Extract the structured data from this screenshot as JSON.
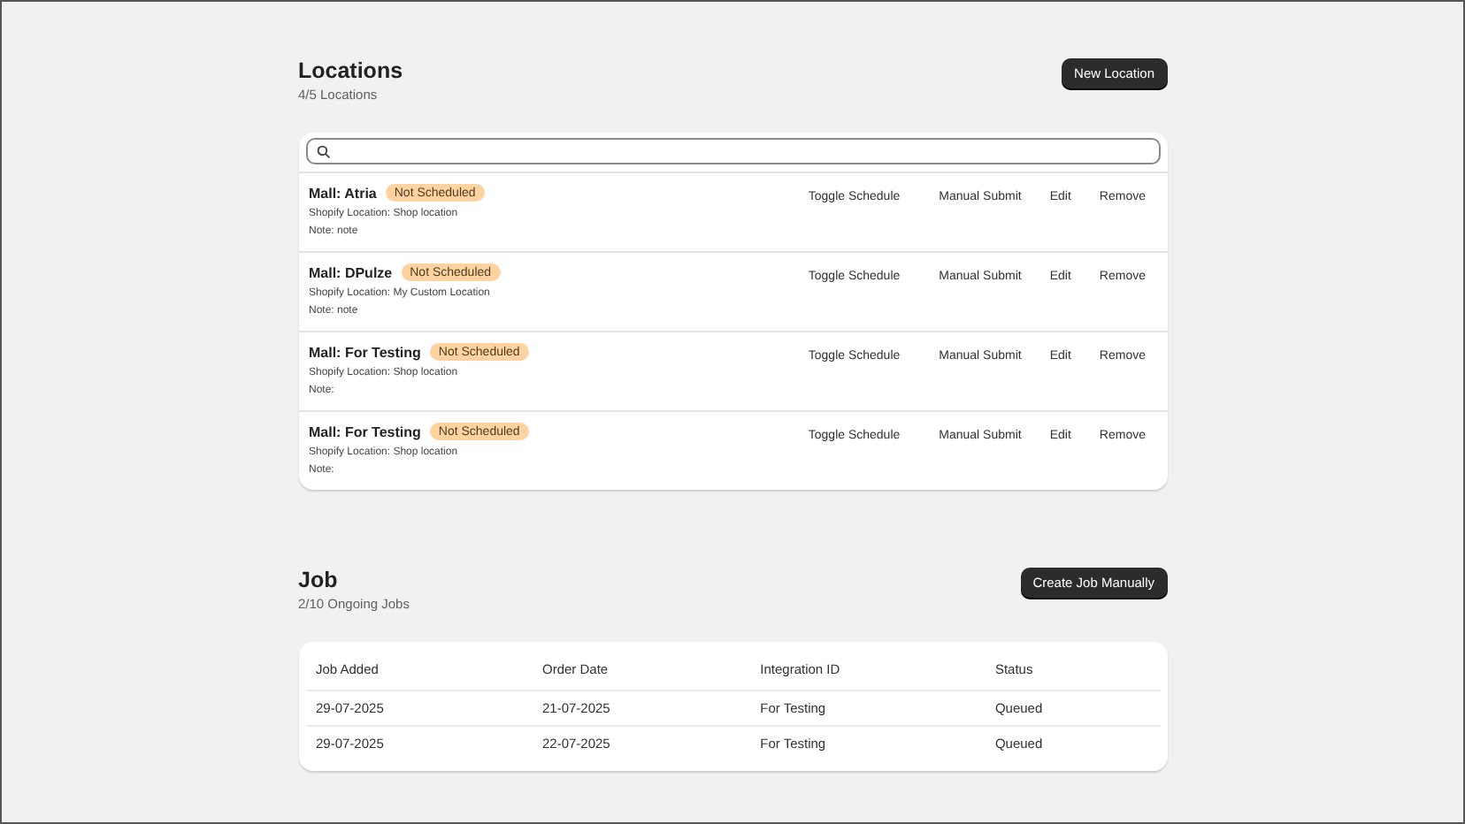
{
  "locations": {
    "title": "Locations",
    "subtitle": "4/5 Locations",
    "new_button": "New Location",
    "items": [
      {
        "name": "Mall: Atria",
        "badge": "Not Scheduled",
        "shopify": "Shopify Location: Shop location",
        "note": "Note: note",
        "actions": [
          "Toggle Schedule",
          "Manual Submit",
          "Edit",
          "Remove"
        ]
      },
      {
        "name": "Mall: DPulze",
        "badge": "Not Scheduled",
        "shopify": "Shopify Location: My Custom Location",
        "note": "Note: note",
        "actions": [
          "Toggle Schedule",
          "Manual Submit",
          "Edit",
          "Remove"
        ]
      },
      {
        "name": "Mall: For Testing",
        "badge": "Not Scheduled",
        "shopify": "Shopify Location: Shop location",
        "note": "Note:",
        "actions": [
          "Toggle Schedule",
          "Manual Submit",
          "Edit",
          "Remove"
        ]
      },
      {
        "name": "Mall: For Testing",
        "badge": "Not Scheduled",
        "shopify": "Shopify Location: Shop location",
        "note": "Note:",
        "actions": [
          "Toggle Schedule",
          "Manual Submit",
          "Edit",
          "Remove"
        ]
      }
    ]
  },
  "job": {
    "title": "Job",
    "subtitle": "2/10 Ongoing Jobs",
    "create_button": "Create Job Manually",
    "table": {
      "columns": [
        "Job Added",
        "Order Date",
        "Integration ID",
        "Status"
      ],
      "rows": [
        [
          "29-07-2025",
          "21-07-2025",
          "For Testing",
          "Queued"
        ],
        [
          "29-07-2025",
          "22-07-2025",
          "For Testing",
          "Queued"
        ]
      ]
    }
  }
}
